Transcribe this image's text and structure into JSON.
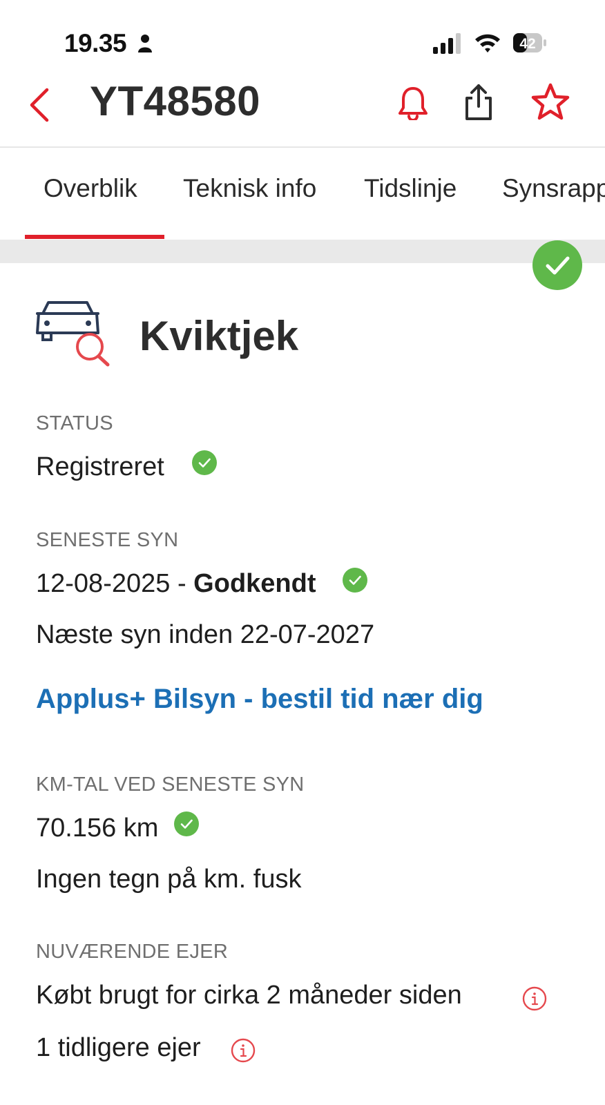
{
  "status_bar": {
    "time": "19.35",
    "battery": "42"
  },
  "header": {
    "title": "YT48580",
    "icons": [
      "back-chevron-icon",
      "bell-icon",
      "share-icon",
      "star-icon"
    ]
  },
  "tabs": [
    {
      "label": "Overblik",
      "active": true
    },
    {
      "label": "Teknisk info",
      "active": false
    },
    {
      "label": "Tidslinje",
      "active": false
    },
    {
      "label": "Synsrapp",
      "active": false
    }
  ],
  "kviktjek": {
    "title": "Kviktjek"
  },
  "status": {
    "label": "STATUS",
    "value": "Registreret"
  },
  "seneste_syn": {
    "label": "SENESTE SYN",
    "date": "12-08-2025",
    "separator": " - ",
    "result": "Godkendt",
    "next": "Næste syn inden 22-07-2027",
    "link": "Applus+ Bilsyn - bestil tid nær dig"
  },
  "km": {
    "label": "KM-TAL VED SENESTE SYN",
    "value": "70.156 km",
    "note": "Ingen tegn på km. fusk"
  },
  "ejer": {
    "label": "NUVÆRENDE EJER",
    "bought": "Købt brugt for cirka 2 måneder siden",
    "previous": "1 tidligere ejer"
  },
  "colors": {
    "accent_red": "#e0202a",
    "check_green": "#5fb84a",
    "link_blue": "#1c6fb5",
    "icon_navy": "#2b3a55"
  }
}
